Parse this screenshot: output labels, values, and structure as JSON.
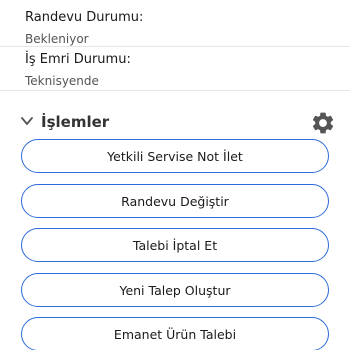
{
  "status": {
    "appointment_label": "Randevu Durumu:",
    "appointment_value": "Bekleniyor",
    "work_order_label": "İş Emri Durumu:",
    "work_order_value": "Teknisyende"
  },
  "actions_section": {
    "title": "İşlemler",
    "buttons": [
      "Yetkili Servise Not İlet",
      "Randevu Değiştir",
      "Talebi İptal Et",
      "Yeni Talep Oluştur",
      "Emanet Ürün Talebi"
    ]
  },
  "colors": {
    "button_border": "#2e6bd9",
    "icon": "#555555"
  },
  "icons": {
    "collapse": "chevron-down-icon",
    "settings": "gear-icon"
  }
}
